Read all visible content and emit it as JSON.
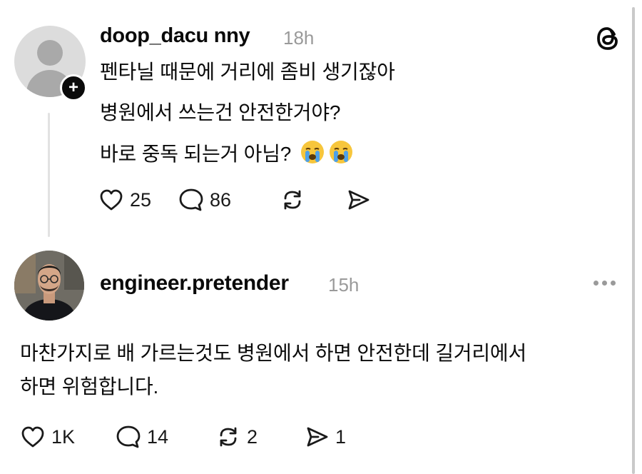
{
  "post1": {
    "username": "doop_dacu nny",
    "time": "18h",
    "lines": [
      "펜타닐 때문에 거리에 좀비 생기잖아",
      "병원에서 쓰는건 안전한거야?",
      "바로 중독 되는거 아님?"
    ],
    "emojis": [
      "loudly-crying-face",
      "loudly-crying-face"
    ],
    "follow_badge": "+",
    "likes": "25",
    "comments": "86",
    "reposts": "",
    "shares": ""
  },
  "post2": {
    "username": "engineer.pretender",
    "time": "15h",
    "lines": [
      "마찬가지로 배 가르는것도 병원에서 하면 안전한데 길거리에서",
      "하면 위험합니다."
    ],
    "likes": "1K",
    "comments": "14",
    "reposts": "2",
    "shares": "1"
  },
  "colors": {
    "text": "#0a0a0a",
    "muted": "#9a9a9a",
    "thread_line": "#e2e2e2",
    "emoji_yellow": "#f7c63c",
    "emoji_tears": "#4ea1e8"
  }
}
